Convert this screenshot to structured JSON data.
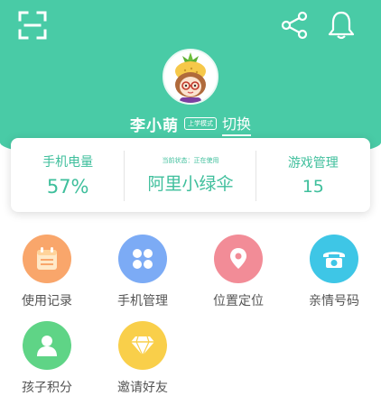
{
  "header": {
    "background_color": "#49CBA6",
    "icons": [
      "scan-icon",
      "share-icon",
      "bell-icon"
    ]
  },
  "profile": {
    "name": "李小萌",
    "mode": "上学模式",
    "switch_label": "切换"
  },
  "stats": {
    "battery_label": "手机电量",
    "battery_value": "57%",
    "status_text": "当前状态：正在使用",
    "app_name": "阿里小绿伞",
    "game_label": "游戏管理",
    "game_value": "15"
  },
  "menu": [
    {
      "label": "使用记录",
      "icon": "record-icon",
      "color": "#F9A66B"
    },
    {
      "label": "手机管理",
      "icon": "phone-manage-icon",
      "color": "#7CABF5"
    },
    {
      "label": "位置定位",
      "icon": "location-icon",
      "color": "#F28C97"
    },
    {
      "label": "亲情号码",
      "icon": "telephone-icon",
      "color": "#3EC6E6"
    },
    {
      "label": "孩子积分",
      "icon": "child-points-icon",
      "color": "#5FD486"
    },
    {
      "label": "邀请好友",
      "icon": "invite-icon",
      "color": "#F9CF4A"
    }
  ]
}
